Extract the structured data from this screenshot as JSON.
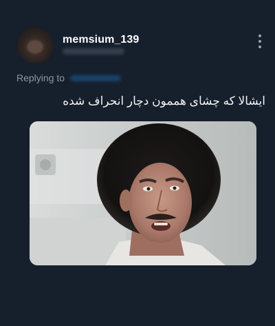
{
  "tweet": {
    "username": "memsium_139",
    "replying_label": "Replying to",
    "text": "ایشالا که چشای هممون دچار انحراف شده"
  },
  "icons": {
    "avatar": "user-avatar",
    "more": "more-vertical-icon",
    "media": "meme-photo"
  },
  "colors": {
    "background": "#161f2c",
    "text": "#e7e9ea",
    "secondary": "#8b98a5",
    "link": "#1d9bf0"
  }
}
